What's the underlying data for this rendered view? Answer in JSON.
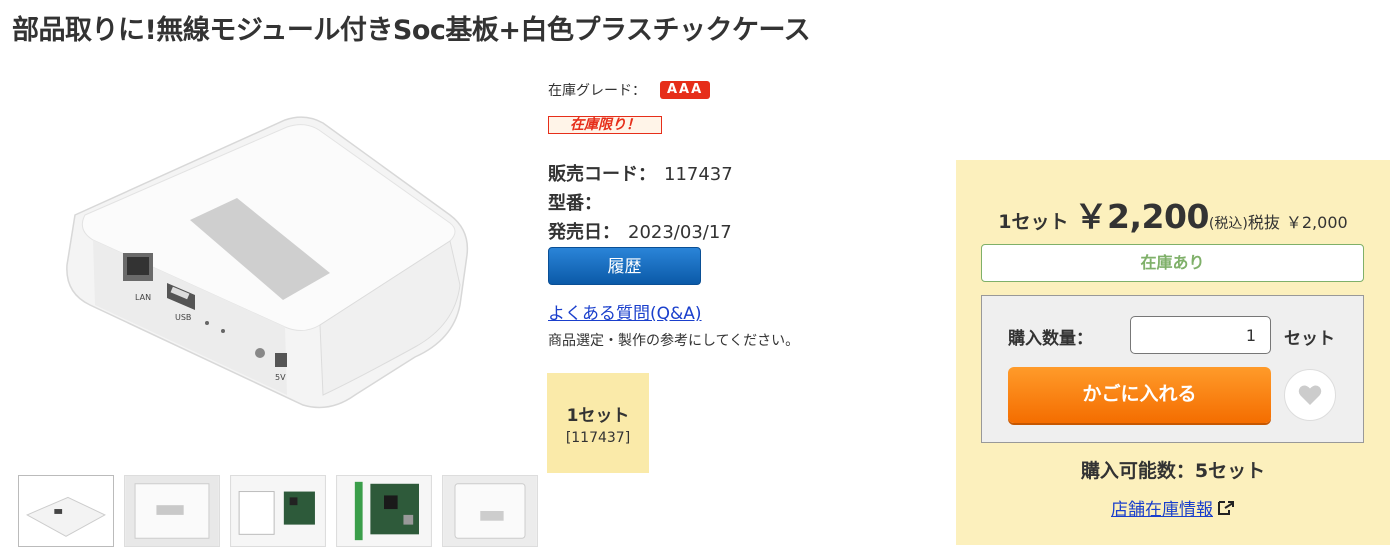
{
  "product": {
    "title": "部品取りに!無線モジュール付きSoc基板+白色プラスチックケース"
  },
  "grade": {
    "label": "在庫グレード：",
    "badge": "AAA"
  },
  "limited_badge": "在庫限り！",
  "specs": {
    "sale_code_label": "販売コード：",
    "sale_code": "117437",
    "model_label": "型番：",
    "model": "",
    "release_label": "発売日：",
    "release_date": "2023/03/17"
  },
  "history_button": "履歴",
  "faq": {
    "link": "よくある質問(Q&A)",
    "note": "商品選定・製作の参考にしてください。"
  },
  "variant": {
    "name": "1セット",
    "code": "[117437]"
  },
  "purchase": {
    "unit": "1セット",
    "price": "￥2,200",
    "tax_note": "(税込)",
    "tax_excl_label": "税抜",
    "tax_excl_price": "￥2,000",
    "stock_status": "在庫あり",
    "qty_label": "購入数量：",
    "qty_value": "1",
    "qty_unit": "セット",
    "cart_button": "かごに入れる",
    "available": "購入可能数：5セット",
    "store_link": "店舗在庫情報"
  },
  "colors": {
    "accent_orange": "#f46d00",
    "panel_bg": "#fcf0bd",
    "badge_red": "#e62e1a",
    "stock_green": "#7fb069",
    "link_blue": "#1a3fcc"
  }
}
